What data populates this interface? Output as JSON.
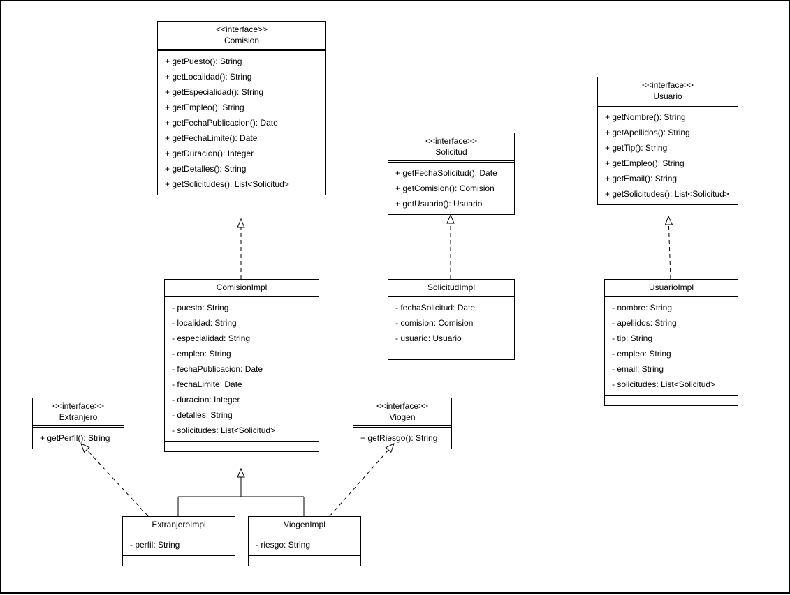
{
  "classes": {
    "comision": {
      "stereo": "<<interface>>",
      "name": "Comision",
      "members": [
        "+ getPuesto(): String",
        "+ getLocalidad(): String",
        "+ getEspecialidad(): String",
        "+ getEmpleo(): String",
        "+ getFechaPublicacion(): Date",
        "+ getFechaLimite(): Date",
        "+ getDuracion(): Integer",
        "+ getDetalles(): String",
        "+ getSolicitudes(): List<Solicitud>"
      ]
    },
    "solicitud": {
      "stereo": "<<interface>>",
      "name": "Solicitud",
      "members": [
        "+ getFechaSolicitud(): Date",
        "+ getComision(): Comision",
        "+ getUsuario(): Usuario"
      ]
    },
    "usuario": {
      "stereo": "<<interface>>",
      "name": "Usuario",
      "members": [
        "+ getNombre(): String",
        "+ getApellidos(): String",
        "+ getTip(): String",
        "+ getEmpleo(): String",
        "+ getEmail(): String",
        "+ getSolicitudes(): List<Solicitud>"
      ]
    },
    "comisionImpl": {
      "name": "ComisionImpl",
      "members": [
        "- puesto: String",
        "- localidad: String",
        "- especialidad: String",
        "- empleo: String",
        "- fechaPublicacion: Date",
        "- fechaLimite: Date",
        "- duracion: Integer",
        "- detalles: String",
        "- solicitudes: List<Solicitud>"
      ]
    },
    "solicitudImpl": {
      "name": "SolicitudImpl",
      "members": [
        "- fechaSolicitud: Date",
        "- comision: Comision",
        "- usuario: Usuario"
      ]
    },
    "usuarioImpl": {
      "name": "UsuarioImpl",
      "members": [
        "- nombre: String",
        "- apellidos: String",
        "- tip: String",
        "- empleo: String",
        "- email: String",
        "- solicitudes: List<Solicitud>"
      ]
    },
    "extranjero": {
      "stereo": "<<interface>>",
      "name": "Extranjero",
      "members": [
        "+ getPerfil(): String"
      ]
    },
    "viogen": {
      "stereo": "<<interface>>",
      "name": "Viogen",
      "members": [
        "+ getRiesgo(): String"
      ]
    },
    "extranjeroImpl": {
      "name": "ExtranjeroImpl",
      "members": [
        "- perfil: String"
      ]
    },
    "viogenImpl": {
      "name": "ViogenImpl",
      "members": [
        "- riesgo: String"
      ]
    }
  }
}
